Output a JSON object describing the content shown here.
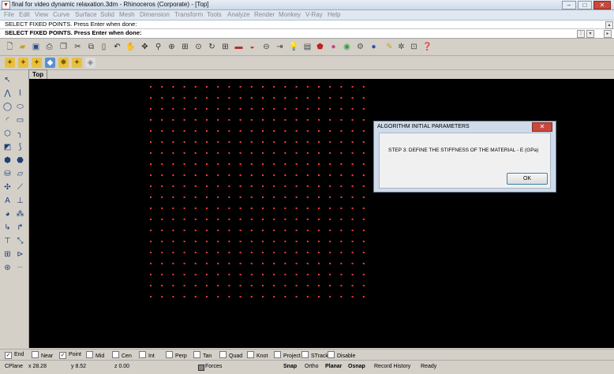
{
  "window": {
    "title": "final for video dynamic relaxation.3dm - Rhinoceros (Corporate) - [Top]",
    "buttons": {
      "minimize": "–",
      "maximize": "□",
      "close": "✕"
    }
  },
  "menu": [
    "File",
    "Edit",
    "View",
    "Curve",
    "Surface",
    "Solid",
    "Mesh",
    "Dimension",
    "Transform",
    "Tools",
    "Analyze",
    "Render",
    "Monkey",
    "V-Ray",
    "Help"
  ],
  "command": {
    "history": "SELECT FIXED POINTS. Press Enter when done:",
    "prompt": "SELECT FIXED POINTS. Press Enter when done:"
  },
  "main_toolbar_icons": [
    "new-icon",
    "open-icon",
    "save-icon",
    "print-icon",
    "import-icon",
    "cut-icon",
    "copy-icon",
    "paste-icon",
    "undo-icon",
    "pan-icon",
    "move-view-icon",
    "zoom-icon",
    "zoom-window-icon",
    "zoom-extents-icon",
    "rotate-view-icon",
    "four-viewports-icon",
    "car-icon",
    "render-icon",
    "undo-view-icon",
    "select-icon",
    "light-icon",
    "layer-icon",
    "material-icon",
    "color-icon",
    "display-icon",
    "sphere-icon",
    "sticky-icon",
    "options-icon",
    "grid-icon",
    "help-icon"
  ],
  "viewport": {
    "name": "Top",
    "background": "#000000",
    "point_color": "#ff3b3b"
  },
  "dialog": {
    "title": "ALGORITHM INITIAL PARAMETERS",
    "message": "STEP 3:  DEFINE THE STIFFNESS OF THE MATERIAL - E (GPa)",
    "ok_label": "OK",
    "close_label": "✕"
  },
  "osnap": [
    {
      "label": "End",
      "checked": true
    },
    {
      "label": "Near",
      "checked": false
    },
    {
      "label": "Point",
      "checked": true
    },
    {
      "label": "Mid",
      "checked": false
    },
    {
      "label": "Cen",
      "checked": false
    },
    {
      "label": "Int",
      "checked": false
    },
    {
      "label": "Perp",
      "checked": false
    },
    {
      "label": "Tan",
      "checked": false
    },
    {
      "label": "Quad",
      "checked": false
    },
    {
      "label": "Knot",
      "checked": false
    },
    {
      "label": "Project",
      "checked": false
    },
    {
      "label": "STrack",
      "checked": false
    },
    {
      "label": "Disable",
      "checked": false
    }
  ],
  "status": {
    "cplane": "CPlane",
    "x": "x 28.28",
    "y": "y 8.52",
    "z": "z 0.00",
    "layer": "Forces",
    "snap": "Snap",
    "ortho": "Ortho",
    "planar": "Planar",
    "osnap": "Osnap",
    "record_history": "Record History",
    "ready": "Ready"
  }
}
